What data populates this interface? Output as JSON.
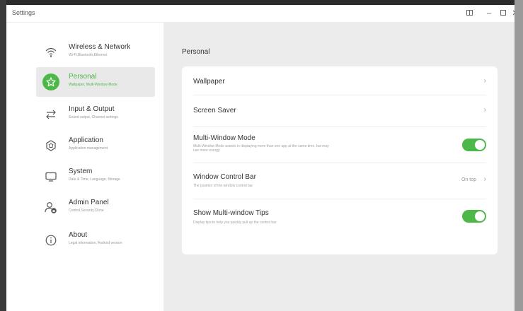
{
  "window": {
    "title": "Settings",
    "controls": [
      "grid-icon",
      "minimize-icon",
      "maximize-icon",
      "close-icon"
    ]
  },
  "sidebar": {
    "items": [
      {
        "label": "Wireless & Network",
        "sub": "Wi-Fi,Bluetooth,Ethernet",
        "icon": "wifi-icon",
        "active": false
      },
      {
        "label": "Personal",
        "sub": "Wallpaper, Multi-Window Mode",
        "icon": "star-icon",
        "active": true
      },
      {
        "label": "Input & Output",
        "sub": "Sound output, Channel settings",
        "icon": "swap-arrows-icon",
        "active": false
      },
      {
        "label": "Application",
        "sub": "Application management",
        "icon": "app-hexagon-icon",
        "active": false
      },
      {
        "label": "System",
        "sub": "Date & Time, Language, Storage",
        "icon": "monitor-icon",
        "active": false
      },
      {
        "label": "Admin Panel",
        "sub": "Control,Security,Clone",
        "icon": "admin-user-icon",
        "active": false
      },
      {
        "label": "About",
        "sub": "Legal information, Android version",
        "icon": "info-icon",
        "active": false
      }
    ]
  },
  "main": {
    "section_title": "Personal",
    "rows": [
      {
        "label": "Wallpaper",
        "type": "link"
      },
      {
        "label": "Screen Saver",
        "type": "link"
      },
      {
        "label": "Multi-Window Mode",
        "desc": "Multi-Window Mode assists in displaying more than one app at the same time, but may use more energy.",
        "type": "toggle",
        "on": true
      },
      {
        "label": "Window Control Bar",
        "desc": "The position of the window control bar",
        "type": "value",
        "value": "On top"
      },
      {
        "label": "Show Multi-window Tips",
        "desc": "Display tips to help you quickly pull up the control bar",
        "type": "toggle",
        "on": true
      }
    ]
  },
  "colors": {
    "accent": "#4cb847",
    "content_bg": "#ececec",
    "card_bg": "#ffffff"
  }
}
